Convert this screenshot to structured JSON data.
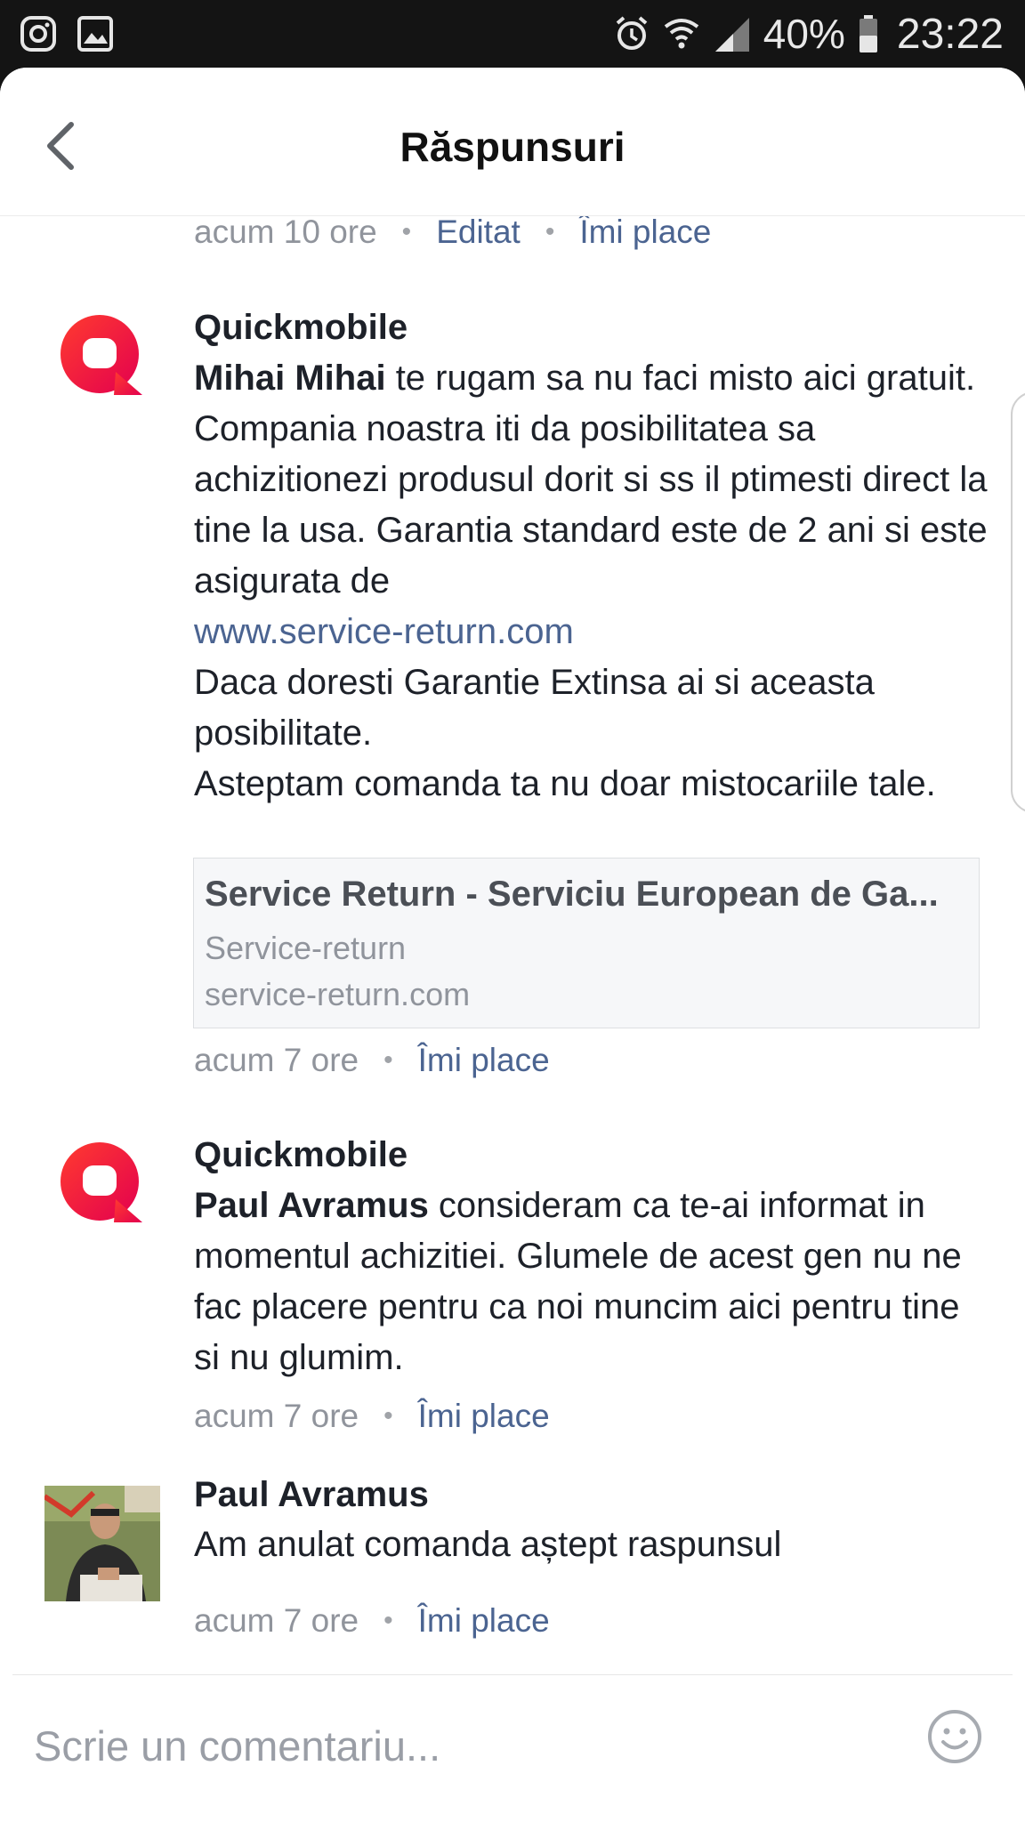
{
  "status_bar": {
    "battery": "40%",
    "time": "23:22",
    "icons": [
      "instagram-icon",
      "gallery-icon",
      "alarm-icon",
      "wifi-icon",
      "signal-icon",
      "battery-icon"
    ]
  },
  "header": {
    "title": "Răspunsuri"
  },
  "top_meta": {
    "time": "acum 10 ore",
    "edited": "Editat",
    "like": "Îmi place"
  },
  "comments": [
    {
      "author": "Quickmobile",
      "mention": "Mihai Mihai",
      "text1": " te rugam sa nu faci misto aici gratuit. Compania noastra iti da posibilitatea sa achizitionezi produsul dorit si ss il ptimesti direct la tine la usa. Garantia standard este de 2 ani si este asigurata de",
      "url": "www.service-return.com",
      "text2": "Daca doresti Garantie Extinsa ai si aceasta posibilitate.",
      "text3": "Asteptam comanda ta nu doar mistocariile tale.",
      "link_preview": {
        "title": "Service Return - Serviciu European de Ga...",
        "site": "Service-return",
        "domain": "service-return.com"
      },
      "time": "acum 7 ore",
      "like": "Îmi place"
    },
    {
      "author": "Quickmobile",
      "mention": "Paul Avramus",
      "text1": " consideram ca te-ai informat in momentul achizitiei. Glumele de acest gen nu ne fac placere pentru ca noi muncim aici pentru tine si nu glumim.",
      "time": "acum 7 ore",
      "like": "Îmi place"
    },
    {
      "author": "Paul Avramus",
      "text1": "Am anulat comanda aștept raspunsul",
      "time": "acum 7 ore",
      "like": "Îmi place"
    }
  ],
  "composer": {
    "placeholder": "Scrie un comentariu..."
  },
  "colors": {
    "link": "#4b6491",
    "meta": "#90949c",
    "brand_red": "#e8132b",
    "text": "#1d2129"
  }
}
